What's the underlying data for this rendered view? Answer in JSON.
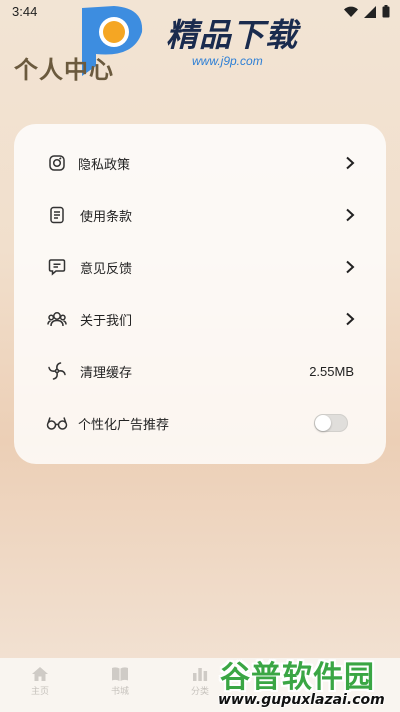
{
  "status_bar": {
    "time": "3:44"
  },
  "page": {
    "title": "个人中心"
  },
  "watermark_top": {
    "title": "精品下载",
    "url": "www.j9p.com"
  },
  "menu": {
    "items": [
      {
        "label": "隐私政策",
        "icon": "privacy-icon",
        "action": "chevron"
      },
      {
        "label": "使用条款",
        "icon": "document-icon",
        "action": "chevron"
      },
      {
        "label": "意见反馈",
        "icon": "feedback-icon",
        "action": "chevron"
      },
      {
        "label": "关于我们",
        "icon": "users-icon",
        "action": "chevron"
      },
      {
        "label": "清理缓存",
        "icon": "fan-icon",
        "value": "2.55MB"
      },
      {
        "label": "个性化广告推荐",
        "icon": "glasses-icon",
        "toggle": false
      }
    ]
  },
  "bottom_nav": {
    "items": [
      {
        "label": "主页",
        "icon": "home-icon"
      },
      {
        "label": "书城",
        "icon": "book-icon"
      },
      {
        "label": "分类",
        "icon": "chart-icon"
      }
    ]
  },
  "watermark_bottom": {
    "title": "谷普软件园",
    "url": "www.gupuxlazai.com"
  },
  "colors": {
    "accent_title": "#6b5a3e",
    "card": "#ffffff",
    "watermark_green": "#3aa644",
    "watermark_blue": "#2d7fd6"
  }
}
